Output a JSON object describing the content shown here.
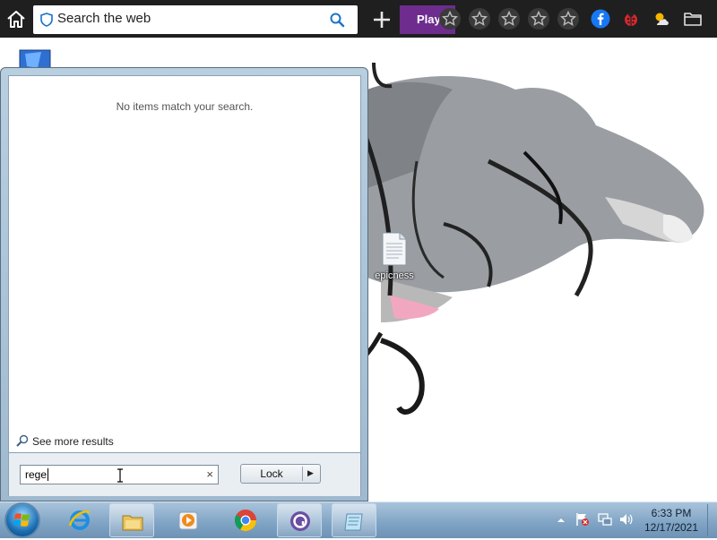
{
  "browser_bar": {
    "search_placeholder": "Search the web",
    "play_label": "Play",
    "star_count": 5,
    "colors": {
      "bar": "#1f1f1f",
      "play": "#6e2c8f",
      "facebook": "#1877f2"
    }
  },
  "desktop": {
    "icons": [
      {
        "label": "epicness"
      }
    ]
  },
  "start_menu": {
    "no_items_text": "No items match your search.",
    "see_more_label": "See more results",
    "search_value": "rege",
    "clear_symbol": "×",
    "lock_label": "Lock"
  },
  "taskbar": {
    "pinned": [
      "ie-icon",
      "explorer-icon",
      "media-player-icon",
      "chrome-icon",
      "app-icon",
      "notepad-icon"
    ],
    "clock": {
      "time": "6:33 PM",
      "date": "12/17/2021"
    }
  }
}
